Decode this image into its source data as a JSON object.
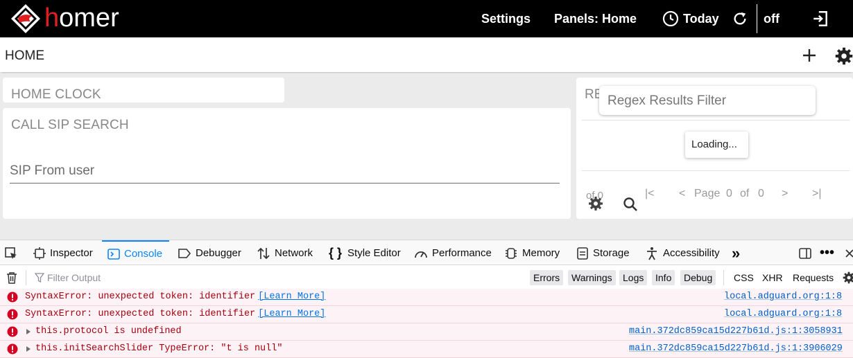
{
  "app": {
    "logo_text_red": "h",
    "logo_text_rest": "omer"
  },
  "topnav": {
    "settings": "Settings",
    "panels": "Panels: Home",
    "today": "Today",
    "off": "off"
  },
  "homebar": {
    "title": "HOME"
  },
  "panels": {
    "clock_title": "HOME CLOCK",
    "sip_title": "CALL SIP SEARCH",
    "sip_field_label": "SIP From user",
    "results_title_partial": "RE",
    "regex_placeholder": "Regex Results Filter",
    "loading": "Loading...",
    "of0": "of 0",
    "pager": {
      "page_label": "Page",
      "current": "0",
      "of_label": "of",
      "total": "0"
    }
  },
  "devtools": {
    "tabs": {
      "inspector": "Inspector",
      "console": "Console",
      "debugger": "Debugger",
      "network": "Network",
      "style_editor": "Style Editor",
      "performance": "Performance",
      "memory": "Memory",
      "storage": "Storage",
      "accessibility": "Accessibility"
    },
    "filter_placeholder": "Filter Output",
    "levels": [
      "Errors",
      "Warnings",
      "Logs",
      "Info",
      "Debug"
    ],
    "request_types": [
      "CSS",
      "XHR",
      "Requests"
    ],
    "messages": [
      {
        "text": "SyntaxError: unexpected token: identifier",
        "link": "[Learn More]",
        "source": "local.adguard.org:1:8"
      },
      {
        "text": "SyntaxError: unexpected token: identifier",
        "link": "[Learn More]",
        "source": "local.adguard.org:1:8"
      },
      {
        "text": "this.protocol is undefined",
        "source": "main.372dc859ca15d227b61d.js:1:3058931"
      },
      {
        "text": "this.initSearchSlider TypeError: \"t is null\"",
        "source": "main.372dc859ca15d227b61d.js:1:3906029"
      }
    ]
  },
  "colors": {
    "accent": "#0a84ff",
    "error_text": "#a4000f",
    "error_bg": "#fdf2f5",
    "logo_red": "#e02020"
  }
}
